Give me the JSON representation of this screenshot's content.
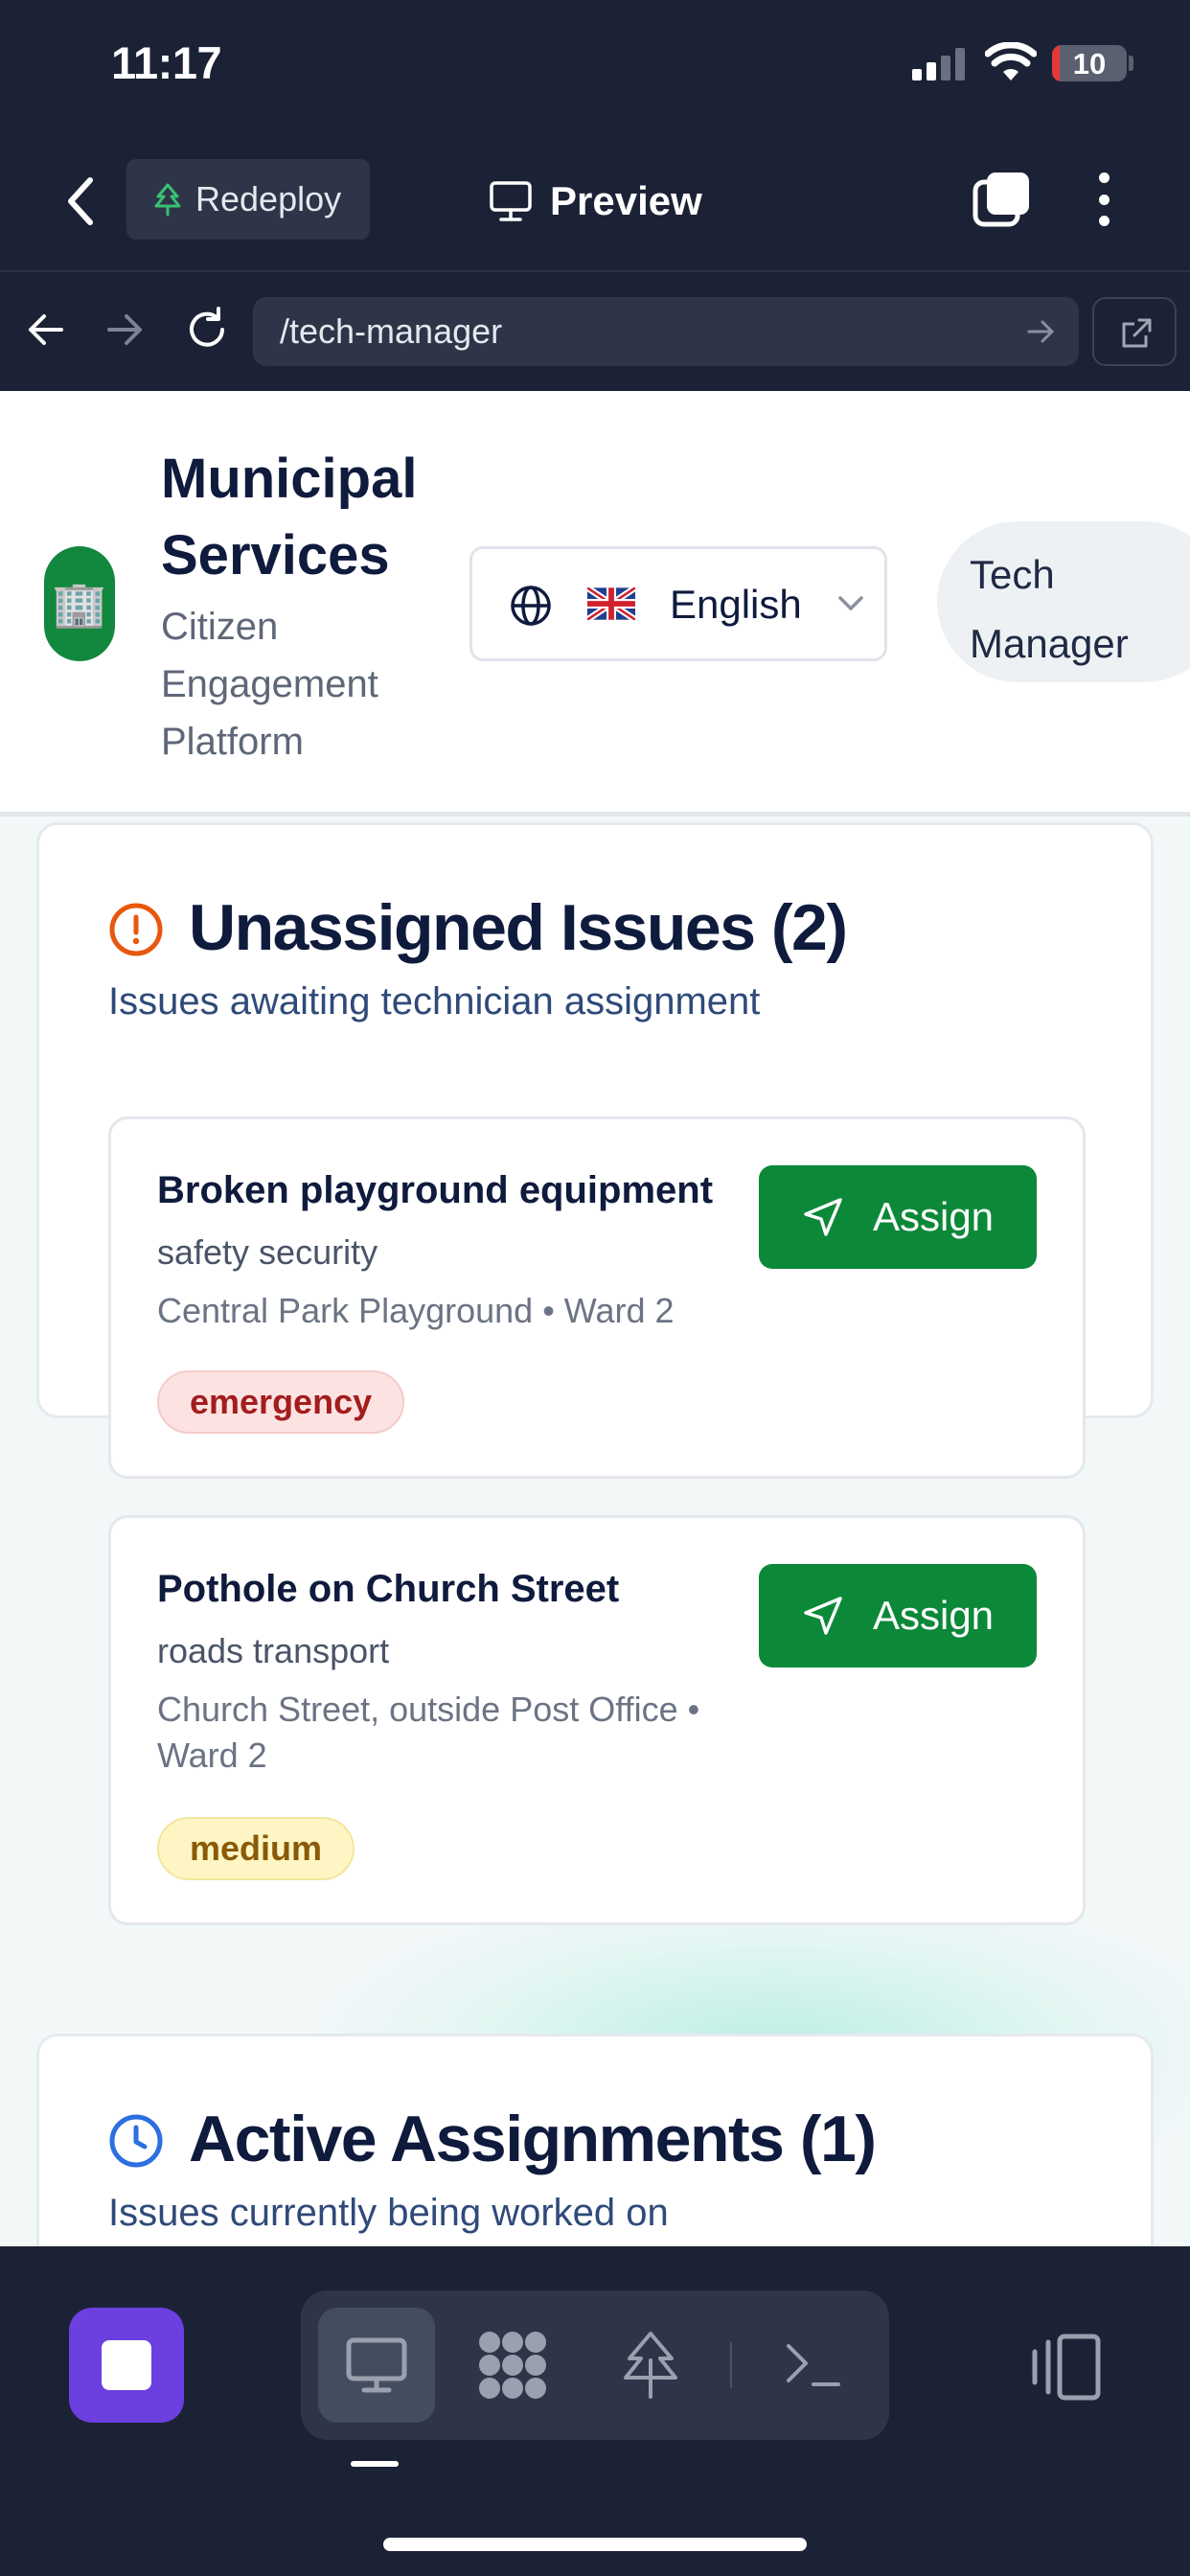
{
  "status_bar": {
    "time": "11:17",
    "battery": "10",
    "battery_level": 0.1
  },
  "toolbar": {
    "redeploy_label": "Redeploy",
    "preview_label": "Preview"
  },
  "url_bar": {
    "path": "/tech-manager"
  },
  "header": {
    "title": "Municipal Services",
    "subtitle": "Citizen Engagement Platform",
    "language": "English",
    "role": "Tech Manager"
  },
  "unassigned": {
    "title": "Unassigned Issues (2)",
    "description": "Issues awaiting technician assignment",
    "issues": [
      {
        "title": "Broken playground equipment",
        "category": "safety security",
        "location": "Central Park Playground • Ward 2",
        "priority": "emergency",
        "action": "Assign"
      },
      {
        "title": "Pothole on Church Street",
        "category": "roads transport",
        "location": "Church Street, outside Post Office • Ward 2",
        "priority": "medium",
        "action": "Assign"
      }
    ]
  },
  "active": {
    "title": "Active Assignments (1)",
    "description": "Issues currently being worked on"
  },
  "colors": {
    "accent_green": "#0c8839",
    "warning_orange": "#e8580c",
    "info_blue": "#2d6fe0",
    "dock_app_purple": "#6c3fe0"
  },
  "icons": {
    "back": "chevron-left-icon",
    "redeploy": "tree-icon",
    "preview": "monitor-icon",
    "tabs": "tabs-icon",
    "more": "more-vertical-icon",
    "globe": "globe-icon",
    "flag": "uk-flag-icon",
    "unassigned": "alert-circle-icon",
    "active": "clock-icon",
    "assign": "send-icon"
  }
}
